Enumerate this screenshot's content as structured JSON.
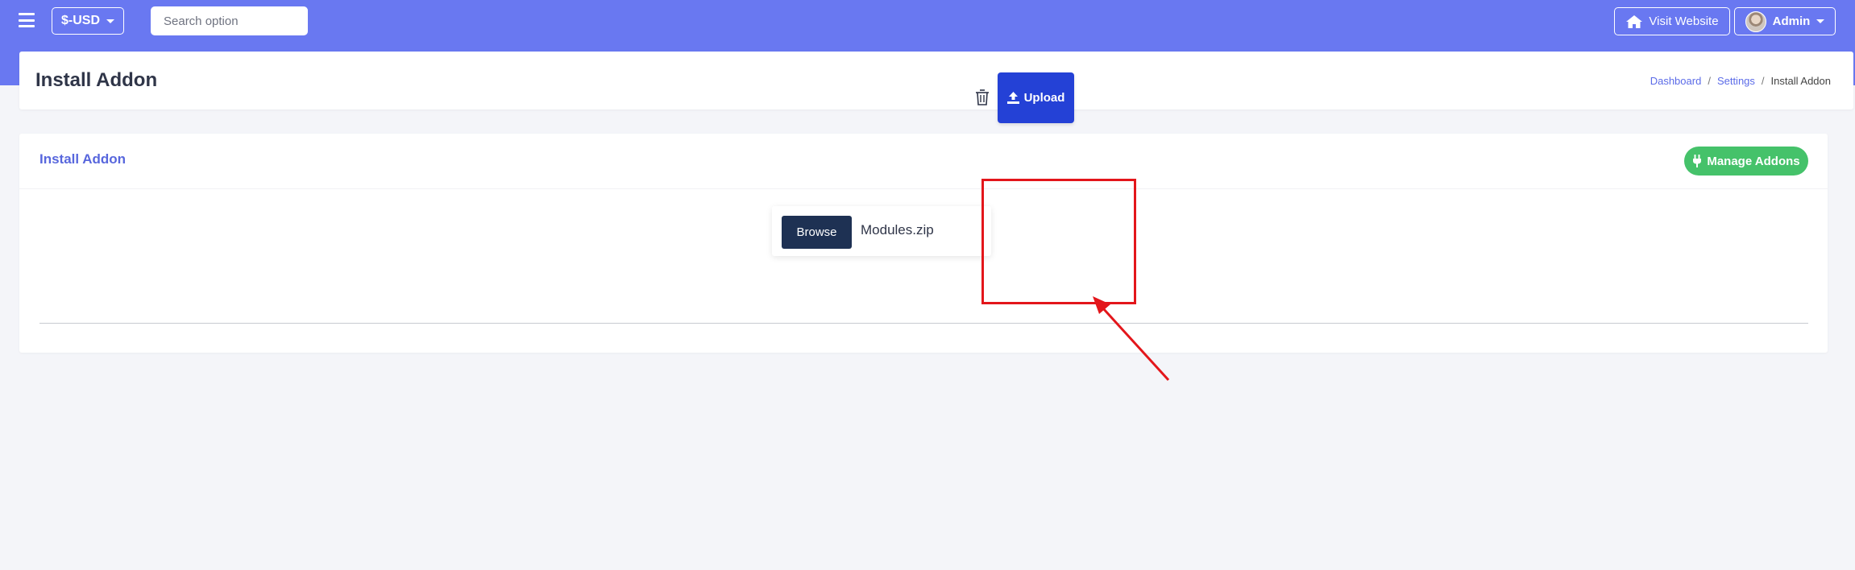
{
  "topbar": {
    "currency_label": "$-USD",
    "search_placeholder": "Search option",
    "visit_label": "Visit Website",
    "admin_label": "Admin"
  },
  "page": {
    "title": "Install Addon",
    "breadcrumb": [
      "Dashboard",
      "Settings",
      "Install Addon"
    ]
  },
  "card": {
    "title": "Install Addon",
    "manage_label": "Manage Addons",
    "browse_label": "Browse",
    "file_name": "Modules.zip",
    "upload_label": "Upload"
  },
  "colors": {
    "header": "#6978f1",
    "accent": "#5867dd",
    "success": "#45c26a",
    "upload": "#2441d6",
    "browse": "#1e3153",
    "annotation": "#e3161b"
  }
}
